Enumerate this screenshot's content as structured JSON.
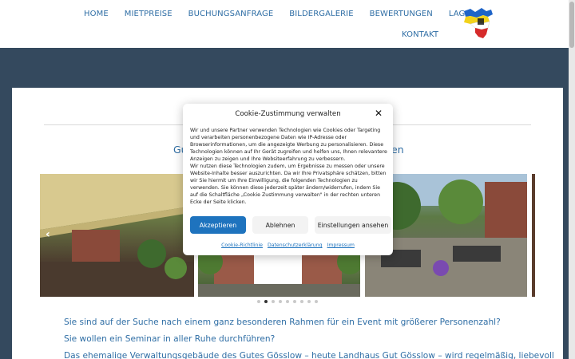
{
  "nav": {
    "items": [
      "HOME",
      "MIETPREISE",
      "BUCHUNGSANFRAGE",
      "BILDERGALERIE",
      "BEWERTUNGEN",
      "LAGE"
    ],
    "row2": [
      "KONTAKT"
    ]
  },
  "content": {
    "subtitle_left": "Gu",
    "subtitle_right": "en",
    "slider": {
      "prev": "‹",
      "next": "›",
      "dots_total": 9,
      "dots_active": 1
    },
    "questions": [
      "Sie sind auf der Suche nach einem ganz besonderen Rahmen für ein Event mit größerer Personenzahl?",
      "Sie wollen ein Seminar in aller Ruhe durchführen?",
      "Das ehemalige Verwaltungsgebäude des Gutes Gösslow – heute Landhaus Gut Gösslow – wird regelmäßig, liebevoll"
    ]
  },
  "cookie": {
    "title": "Cookie-Zustimmung verwalten",
    "close": "✕",
    "text1": "Wir und unsere Partner verwenden Technologien wie Cookies oder Targeting und verarbeiten personenbezogene Daten wie IP-Adresse oder Browserinformationen, um die angezeigte Werbung zu personalisieren. Diese Technologien können auf Ihr Gerät zugreifen und helfen uns, Ihnen relevantere Anzeigen zu zeigen und Ihre Websiteerfahrung zu verbessern.",
    "text2": "Wir nutzen diese Technologien zudem, um Ergebnisse zu messen oder unsere Website-Inhalte besser auszurichten. Da wir Ihre Privatsphäre schätzen, bitten wir Sie hiermit um Ihre Einwilligung, die folgenden Technologien zu verwenden. Sie können diese jederzeit später ändern/widerrufen, indem Sie auf die Schaltfläche „Cookie Zustimmung verwalten\" in der rechten unteren Ecke der Seite klicken.",
    "buttons": {
      "accept": "Akzeptieren",
      "deny": "Ablehnen",
      "settings": "Einstellungen ansehen"
    },
    "links": [
      "Cookie-Richtlinie",
      "Datenschutzerklärung",
      "Impressum"
    ]
  },
  "colors": {
    "nav": "#2f6ea5",
    "accent": "#1e73be",
    "page_bg": "#34495e"
  }
}
